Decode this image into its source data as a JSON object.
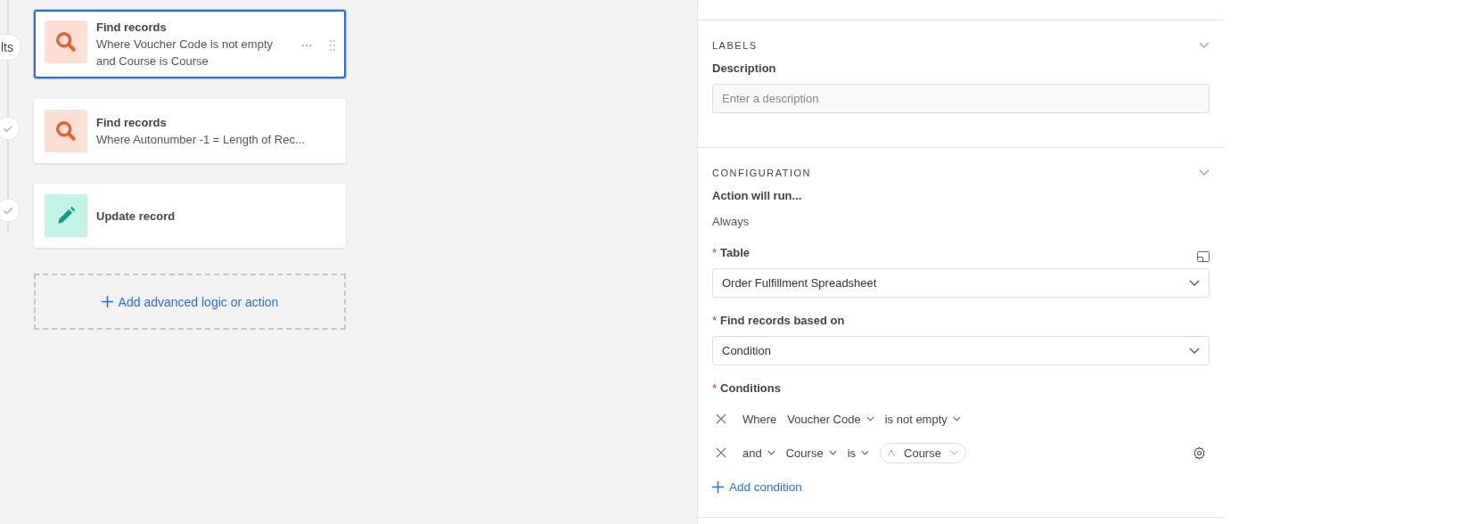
{
  "timeline": [
    {
      "kind": "label",
      "text": "lts"
    },
    {
      "kind": "check"
    },
    {
      "kind": "check"
    }
  ],
  "steps": [
    {
      "kind": "search",
      "title": "Find records",
      "detail": [
        "Where Voucher Code is not empty",
        "and Course is Course"
      ],
      "selected": true
    },
    {
      "kind": "search",
      "title": "Find records",
      "detail": [
        "Where Autonumber -1 = Length of Rec..."
      ],
      "selected": false
    },
    {
      "kind": "edit",
      "title": "Update record",
      "selected": false
    }
  ],
  "add_action": "Add advanced logic or action",
  "labels": {
    "heading": "LABELS",
    "description_label": "Description",
    "placeholder": "Enter a description"
  },
  "configuration": {
    "heading": "CONFIGURATION",
    "run_label": "Action will run...",
    "run_value": "Always",
    "table": {
      "required_mark": "*",
      "label": "Table",
      "value": "Order Fulfillment Spreadsheet"
    },
    "basis": {
      "required_mark": "*",
      "label": "Find records based on",
      "value": "Condition"
    },
    "conditions_label": {
      "required_mark": "*",
      "label": "Conditions"
    },
    "conditions": [
      {
        "conjunction": "Where",
        "conjunction_menu": false,
        "field": "Voucher Code",
        "operator": "is not empty",
        "settings": false
      },
      {
        "conjunction": "and",
        "conjunction_menu": true,
        "field": "Course",
        "operator": "is",
        "value": "Course",
        "settings": true
      }
    ],
    "add_condition": "Add condition"
  }
}
